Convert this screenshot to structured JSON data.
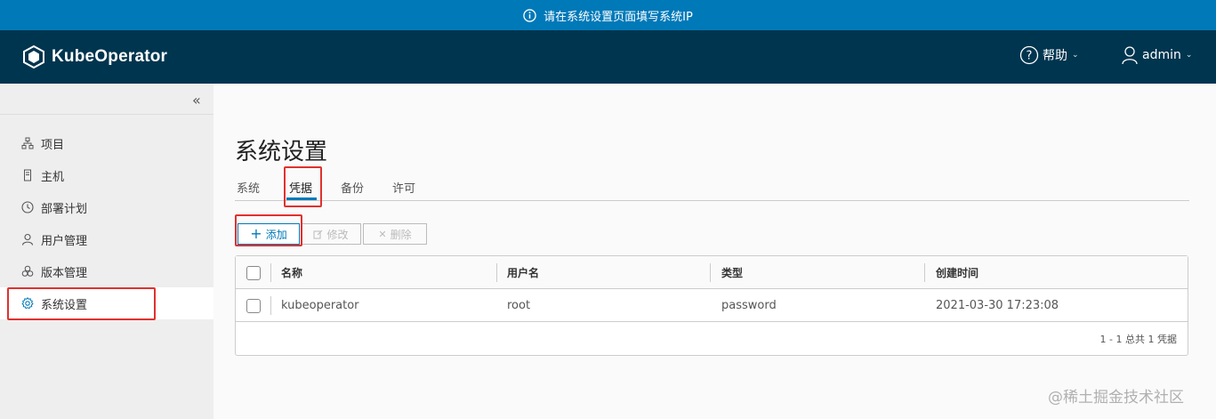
{
  "banner": {
    "text": "请在系统设置页面填写系统IP",
    "icon": "info-icon"
  },
  "header": {
    "brand": "KubeOperator",
    "help_label": "帮助",
    "user_label": "admin"
  },
  "sidebar": {
    "items": [
      {
        "label": "项目",
        "icon": "project-icon"
      },
      {
        "label": "主机",
        "icon": "host-icon"
      },
      {
        "label": "部署计划",
        "icon": "clock-icon"
      },
      {
        "label": "用户管理",
        "icon": "user-icon"
      },
      {
        "label": "版本管理",
        "icon": "version-icon"
      },
      {
        "label": "系统设置",
        "icon": "gear-icon",
        "active": true
      }
    ]
  },
  "main": {
    "title": "系统设置",
    "tabs": [
      "系统",
      "凭据",
      "备份",
      "许可"
    ],
    "active_tab": "凭据",
    "toolbar": {
      "add_label": "添加",
      "edit_label": "修改",
      "delete_label": "删除"
    },
    "table": {
      "columns": [
        "名称",
        "用户名",
        "类型",
        "创建时间"
      ],
      "rows": [
        [
          "kubeoperator",
          "root",
          "password",
          "2021-03-30 17:23:08"
        ]
      ],
      "footer": "1 - 1 总共 1 凭据"
    }
  },
  "watermark": "@稀土掘金技术社区",
  "colors": {
    "banner": "#0079b8",
    "header": "#00354f",
    "highlight": "#e0312e"
  }
}
